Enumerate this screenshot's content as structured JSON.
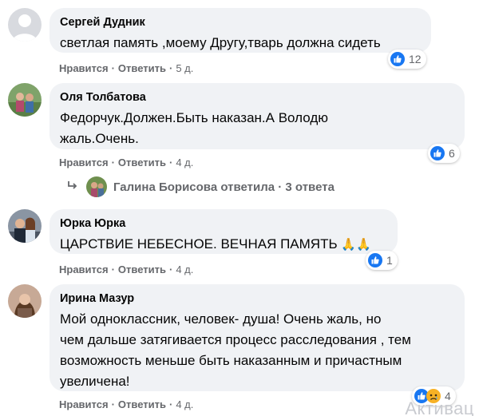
{
  "comments": [
    {
      "author": "Сергей Дудник",
      "text": [
        "светлая память ,моему Другу,тварь должна сидеть"
      ],
      "like_label": "Нравится",
      "reply_label": "Ответить",
      "time": "5 д.",
      "reaction_count": "12",
      "reactions": [
        "like-icon"
      ]
    },
    {
      "author": "Оля Толбатова",
      "text": [
        "Федорчук.Должен.Быть наказан.А Володю",
        "жаль.Очень."
      ],
      "like_label": "Нравится",
      "reply_label": "Ответить",
      "time": "4 д.",
      "reaction_count": "6",
      "reactions": [
        "like-icon"
      ]
    },
    {
      "author": "Юрка Юрка",
      "text": [
        "ЦАРСТВИЕ НЕБЕСНОЕ. ВЕЧНАЯ ПАМЯТЬ"
      ],
      "like_label": "Нравится",
      "reply_label": "Ответить",
      "time": "4 д.",
      "reaction_count": "1",
      "reactions": [
        "like-icon"
      ]
    },
    {
      "author": "Ирина Мазур",
      "text": [
        "Мой одноклассник, человек- душа! Очень жаль, но",
        "чем дальше затягивается процесс расследования , тем",
        "возможность меньше быть наказанным и причастным",
        "увеличена!"
      ],
      "like_label": "Нравится",
      "reply_label": "Ответить",
      "time": "4 д.",
      "reaction_count": "4",
      "reactions": [
        "like-icon",
        "sad-icon"
      ]
    }
  ],
  "reply_summary": "Галина Борисова ответила · 3 ответа",
  "emoji_praying": "🙏🙏",
  "dot": "·",
  "watermark": "Активац",
  "colors": {
    "bubble": "#f0f2f5",
    "like_blue": "#1877f2",
    "secondary_text": "#65676b",
    "sad_yellow": "#f7b125"
  }
}
